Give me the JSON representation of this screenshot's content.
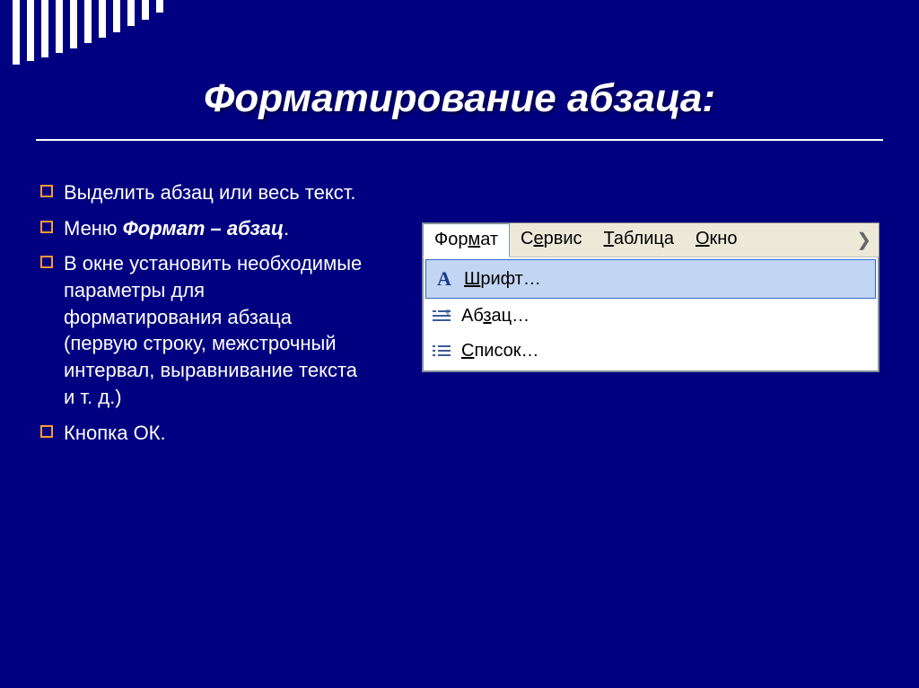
{
  "title": "Форматирование абзаца:",
  "bullets": {
    "b0": "Выделить абзац или весь текст.",
    "b1_pre": "Меню ",
    "b1_bi": "Формат – абзац",
    "b1_post": ".",
    "b2": "В окне установить необходимые параметры для форматирования абзаца (первую строку, межстрочный интервал, выравнивание текста и т. д.)",
    "b3": "Кнопка ОК."
  },
  "menu": {
    "format": "Формат",
    "service": "Сервис",
    "table": "Таблица",
    "window": "Окно",
    "font": "Шрифт…",
    "paragraph": "Абзац…",
    "list": "Список…"
  }
}
